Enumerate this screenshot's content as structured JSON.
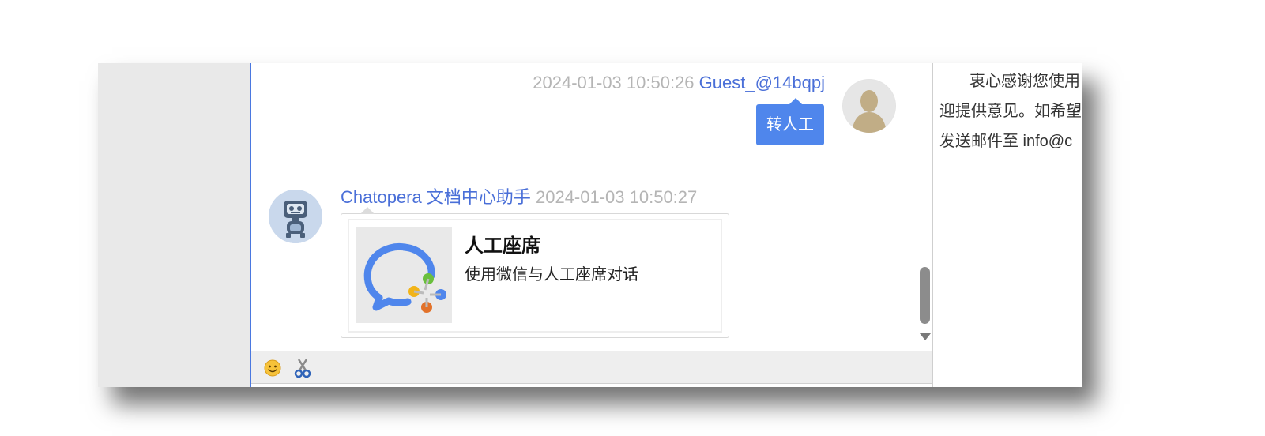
{
  "chat": {
    "guest_message": {
      "timestamp": "2024-01-03 10:50:26",
      "sender": "Guest_@14bqpj",
      "text": "转人工"
    },
    "bot_message": {
      "sender": "Chatopera 文档中心助手",
      "timestamp": "2024-01-03 10:50:27",
      "card": {
        "title": "人工座席",
        "description": "使用微信与人工座席对话",
        "image_icon": "wecom-logo-icon"
      }
    }
  },
  "right_panel": {
    "notice_lines": [
      "衷心感谢您使用",
      "迎提供意见。如希望",
      "发送邮件至 info@c"
    ]
  },
  "toolbar": {
    "icons": [
      "emoji-icon",
      "screenshot-scissors-icon"
    ]
  },
  "colors": {
    "accent": "#4f86ec",
    "name_link": "#4a6fd8",
    "timestamp": "#b5b5b5",
    "panel_gray": "#e9e9e9"
  }
}
